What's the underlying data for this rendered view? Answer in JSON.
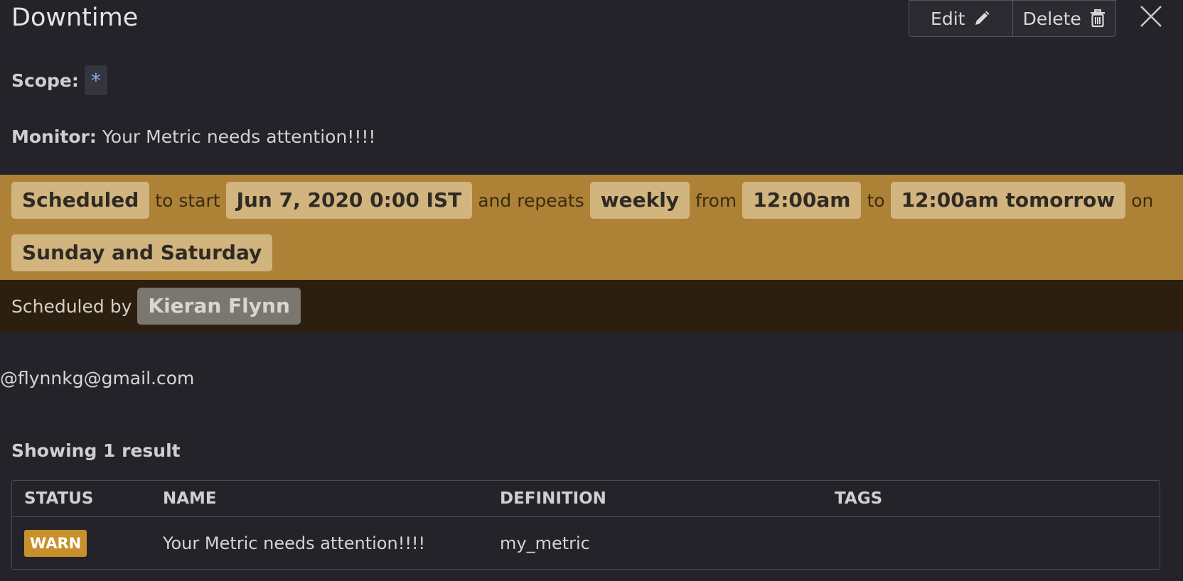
{
  "header": {
    "title": "Downtime",
    "edit_label": "Edit",
    "delete_label": "Delete"
  },
  "scope": {
    "label": "Scope:",
    "value": "*"
  },
  "monitor": {
    "label": "Monitor:",
    "value": "Your Metric needs attention!!!!"
  },
  "schedule": {
    "status": "Scheduled",
    "to_start_text": "to start",
    "start": "Jun 7, 2020 0:00 IST",
    "repeats_text": "and repeats",
    "frequency": "weekly",
    "from_text": "from",
    "from_time": "12:00am",
    "to_text": "to",
    "to_time": "12:00am tomorrow",
    "on_text": "on",
    "days": "Sunday and Saturday"
  },
  "scheduled_by": {
    "label": "Scheduled by",
    "user": "Kieran Flynn",
    "email": "@flynnkg@gmail.com"
  },
  "results": {
    "summary": "Showing 1 result",
    "columns": [
      "STATUS",
      "NAME",
      "DEFINITION",
      "TAGS"
    ],
    "rows": [
      {
        "status": "WARN",
        "name": "Your Metric needs attention!!!!",
        "definition": "my_metric",
        "tags": ""
      }
    ]
  },
  "colors": {
    "background": "#232329",
    "schedule_band": "#ad8236",
    "scheduled_by_band": "#2c1f0f",
    "warn": "#c8902a"
  },
  "icons": {
    "edit": "pencil-icon",
    "delete": "trash-icon",
    "close": "close-icon"
  }
}
